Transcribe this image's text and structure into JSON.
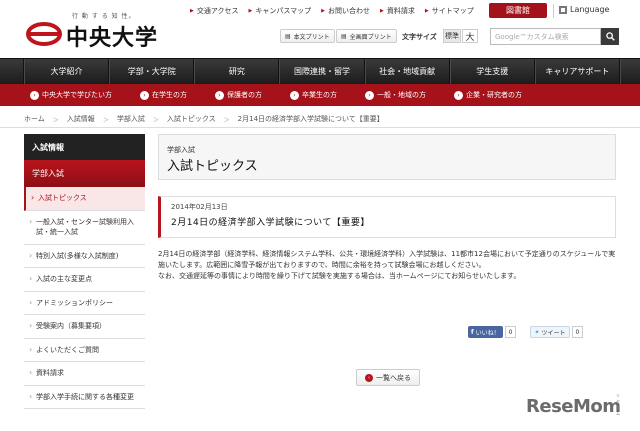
{
  "header": {
    "tagline": "行 動 す る 知 性。",
    "logo_name": "中央大学",
    "util_links": [
      "交通アクセス",
      "キャンパスマップ",
      "お問い合わせ",
      "資料請求",
      "サイトマップ"
    ],
    "library_label": "図書館",
    "language_label": "Language",
    "print_body_label": "本文プリント",
    "print_all_label": "全画面プリント",
    "font_size_label": "文字サイズ",
    "font_standard": "標準",
    "font_large": "大",
    "search_placeholder": "Google™カスタム検索"
  },
  "main_nav": [
    "大学紹介",
    "学部・大学院",
    "研究",
    "国際連携・留学",
    "社会・地域貢献",
    "学生支援",
    "キャリアサポート"
  ],
  "sub_nav": [
    "中央大学で学びたい方",
    "在学生の方",
    "保護者の方",
    "卒業生の方",
    "一般・地域の方",
    "企業・研究者の方"
  ],
  "breadcrumb": [
    "ホーム",
    "入試情報",
    "学部入試",
    "入試トピックス",
    "2月14日の経済学部入学試験について【重要】"
  ],
  "sidebar": {
    "heading": "入試情報",
    "subheading": "学部入試",
    "items": [
      "入試トピックス",
      "一般入試・センター試験利用入試・統一入試",
      "特別入試(多様な入試制度)",
      "入試の主な変更点",
      "アドミッションポリシー",
      "受験案内（募集要項）",
      "よくいただくご質問",
      "資料請求",
      "学部入学手続に関する各種変更"
    ]
  },
  "content": {
    "kicker": "学部入試",
    "title": "入試トピックス",
    "date": "2014年02月13日",
    "headline": "2月14日の経済学部入学試験について【重要】",
    "paragraph1": "2月14日の経済学部（経済学科、経済情報システム学科、公共・環境経済学科）入学試験は、11都市12会場において予定通りのスケジュールで実施いたします。広範囲に降雪予報が出ておりますので、時間に余裕を持って試験会場にお越しください。",
    "paragraph2": "なお、交通遅延等の事情により時間を繰り下げて試験を実施する場合は、当ホームページにてお知らせいたします。",
    "fb_label": "いいね！",
    "fb_count": "0",
    "tw_label": "ツイート",
    "tw_count": "0",
    "back_label": "一覧へ戻る"
  },
  "watermark": {
    "text": "ReseMom",
    "small": "リセマム"
  },
  "colors": {
    "brand_red": "#a5121a",
    "nav_dark": "#222222"
  }
}
